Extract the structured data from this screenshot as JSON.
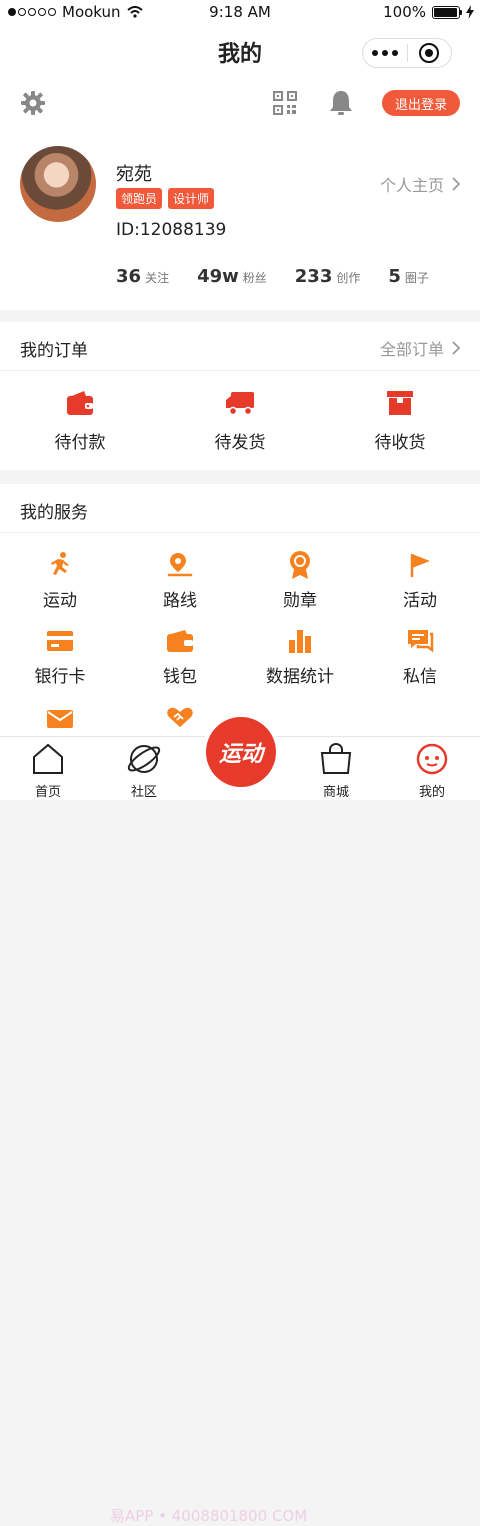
{
  "status_bar": {
    "carrier": "Mookun",
    "time": "9:18 AM",
    "battery": "100%"
  },
  "nav": {
    "title": "我的"
  },
  "toolbar": {
    "logout_label": "退出登录"
  },
  "profile": {
    "nickname": "宛苑",
    "badges": [
      "领跑员",
      "设计师"
    ],
    "user_id": "ID:12088139",
    "homepage_label": "个人主页",
    "stats": [
      {
        "value": "36",
        "label": "关注"
      },
      {
        "value": "49w",
        "label": "粉丝"
      },
      {
        "value": "233",
        "label": "创作"
      },
      {
        "value": "5",
        "label": "圈子"
      }
    ]
  },
  "orders": {
    "title": "我的订单",
    "all_label": "全部订单",
    "items": [
      {
        "label": "待付款",
        "icon": "wallet-icon"
      },
      {
        "label": "待发货",
        "icon": "truck-icon"
      },
      {
        "label": "待收货",
        "icon": "box-icon"
      }
    ]
  },
  "services": {
    "title": "我的服务",
    "items": [
      {
        "label": "运动",
        "icon": "running-icon"
      },
      {
        "label": "路线",
        "icon": "route-icon"
      },
      {
        "label": "勋章",
        "icon": "medal-icon"
      },
      {
        "label": "活动",
        "icon": "flag-icon"
      },
      {
        "label": "银行卡",
        "icon": "bank-card-icon"
      },
      {
        "label": "钱包",
        "icon": "wallet-icon"
      },
      {
        "label": "数据统计",
        "icon": "bar-chart-icon"
      },
      {
        "label": "私信",
        "icon": "message-icon"
      },
      {
        "label": "",
        "icon": "mail-icon"
      },
      {
        "label": "",
        "icon": "handshake-icon"
      }
    ]
  },
  "tabbar": {
    "items": [
      {
        "label": "首页",
        "icon": "home-icon"
      },
      {
        "label": "社区",
        "icon": "planet-icon"
      },
      {
        "label": "商城",
        "icon": "shopping-bag-icon"
      },
      {
        "label": "我的",
        "icon": "profile-face-icon"
      }
    ],
    "center_label": "运动",
    "watermark": "易APP • 4008801800 COM"
  },
  "colors": {
    "accent": "#f0593a",
    "orange": "#f5821f",
    "red": "#e63a2a"
  }
}
